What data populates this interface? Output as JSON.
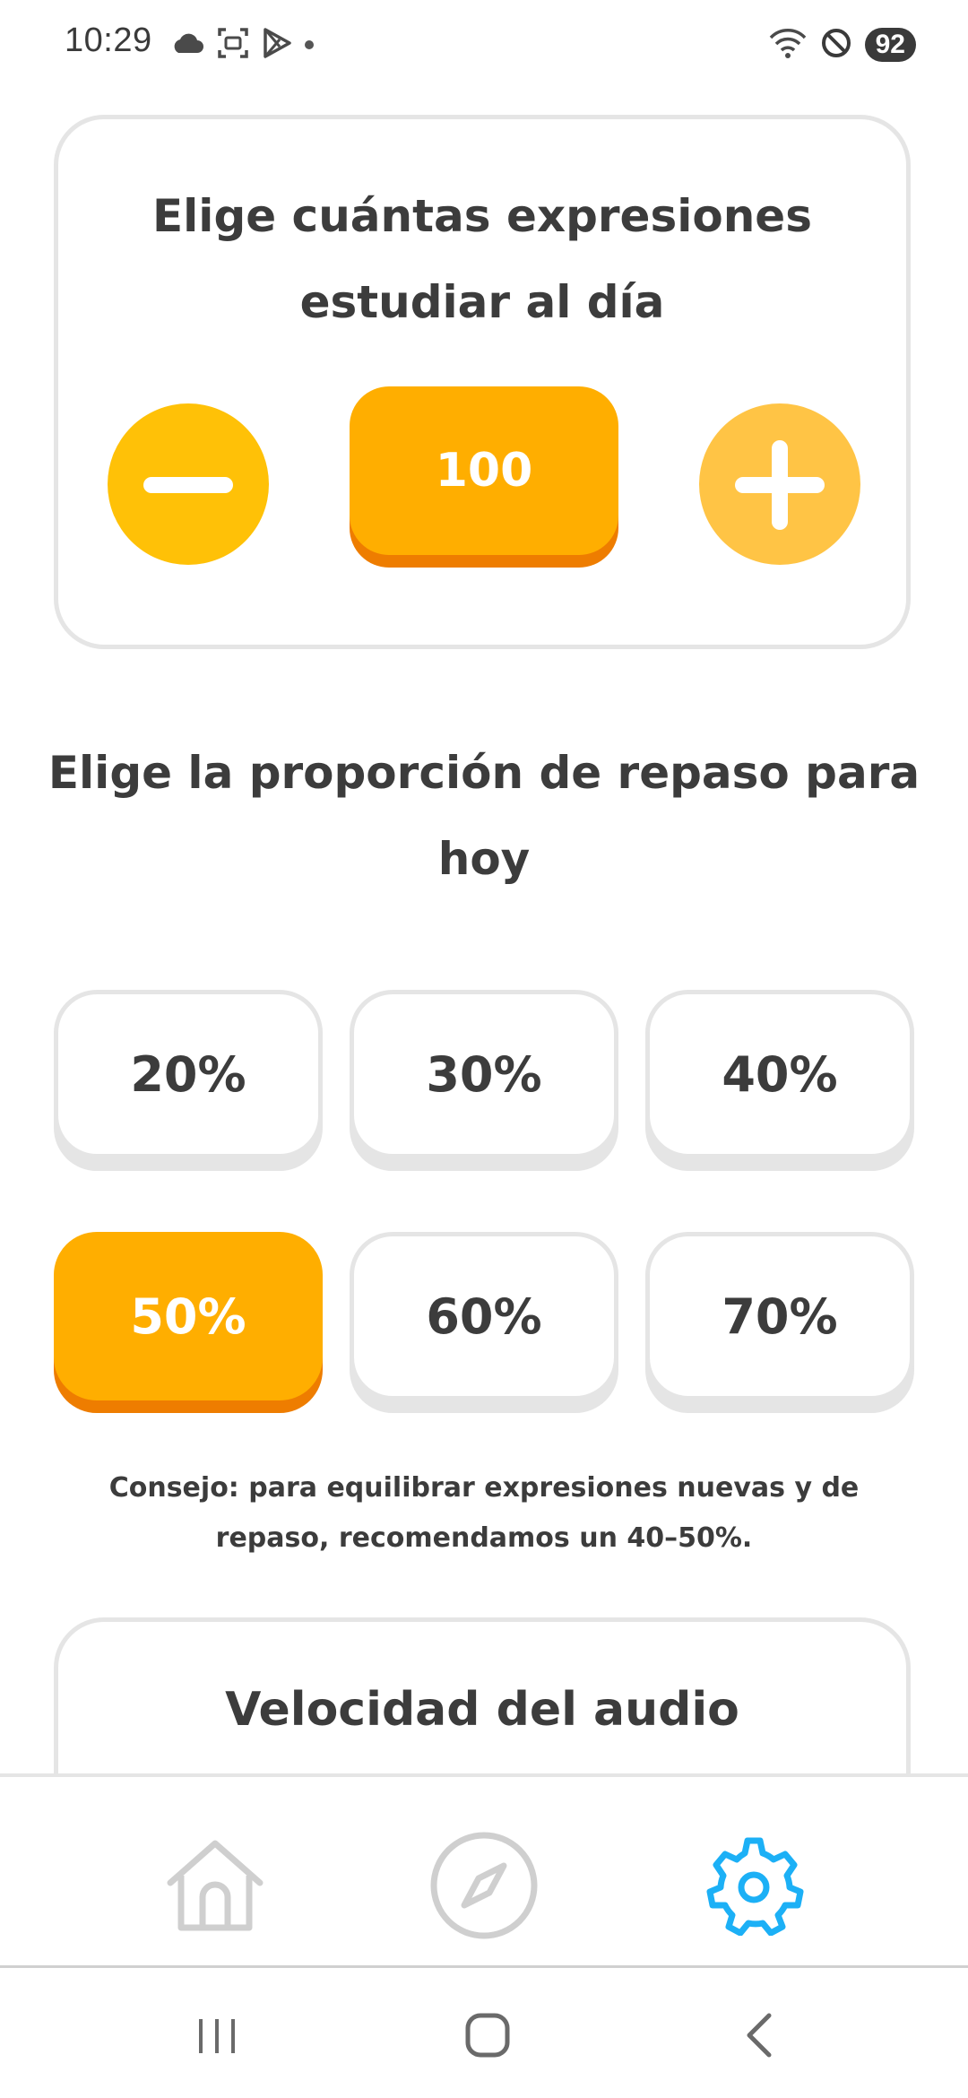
{
  "status_bar": {
    "time": "10:29",
    "battery": "92",
    "icons_left": [
      "cloud-icon",
      "screenshot-icon",
      "play-store-icon",
      "notification-dot-icon"
    ],
    "icons_right": [
      "wifi-icon",
      "do-not-disturb-icon",
      "battery-icon"
    ]
  },
  "daily_goal": {
    "title": "Elige cuántas expresiones estudiar al día",
    "value": "100",
    "decrease_icon": "minus-icon",
    "increase_icon": "plus-icon"
  },
  "review_ratio": {
    "title": "Elige la proporción de repaso para hoy",
    "options": [
      "20%",
      "30%",
      "40%",
      "50%",
      "60%",
      "70%"
    ],
    "selected": "50%",
    "tip": "Consejo: para equilibrar expresiones nuevas y de repaso, recomendamos un 40–50%."
  },
  "audio_speed": {
    "title": "Velocidad del audio"
  },
  "bottom_nav": {
    "items": [
      {
        "icon": "home-icon",
        "active": false
      },
      {
        "icon": "compass-icon",
        "active": false
      },
      {
        "icon": "gear-icon",
        "active": true
      }
    ]
  },
  "colors": {
    "accent": "#ffae00",
    "accent_shadow": "#ee7d00",
    "minus_button": "#ffc107",
    "plus_button": "#ffc445",
    "active_nav": "#1cb0f6",
    "inactive_nav": "#cfcfcf",
    "border": "#e5e5e5",
    "text": "#3c3c3c"
  },
  "system_nav": {
    "icons": [
      "recents-icon",
      "home-button-icon",
      "back-icon"
    ]
  }
}
